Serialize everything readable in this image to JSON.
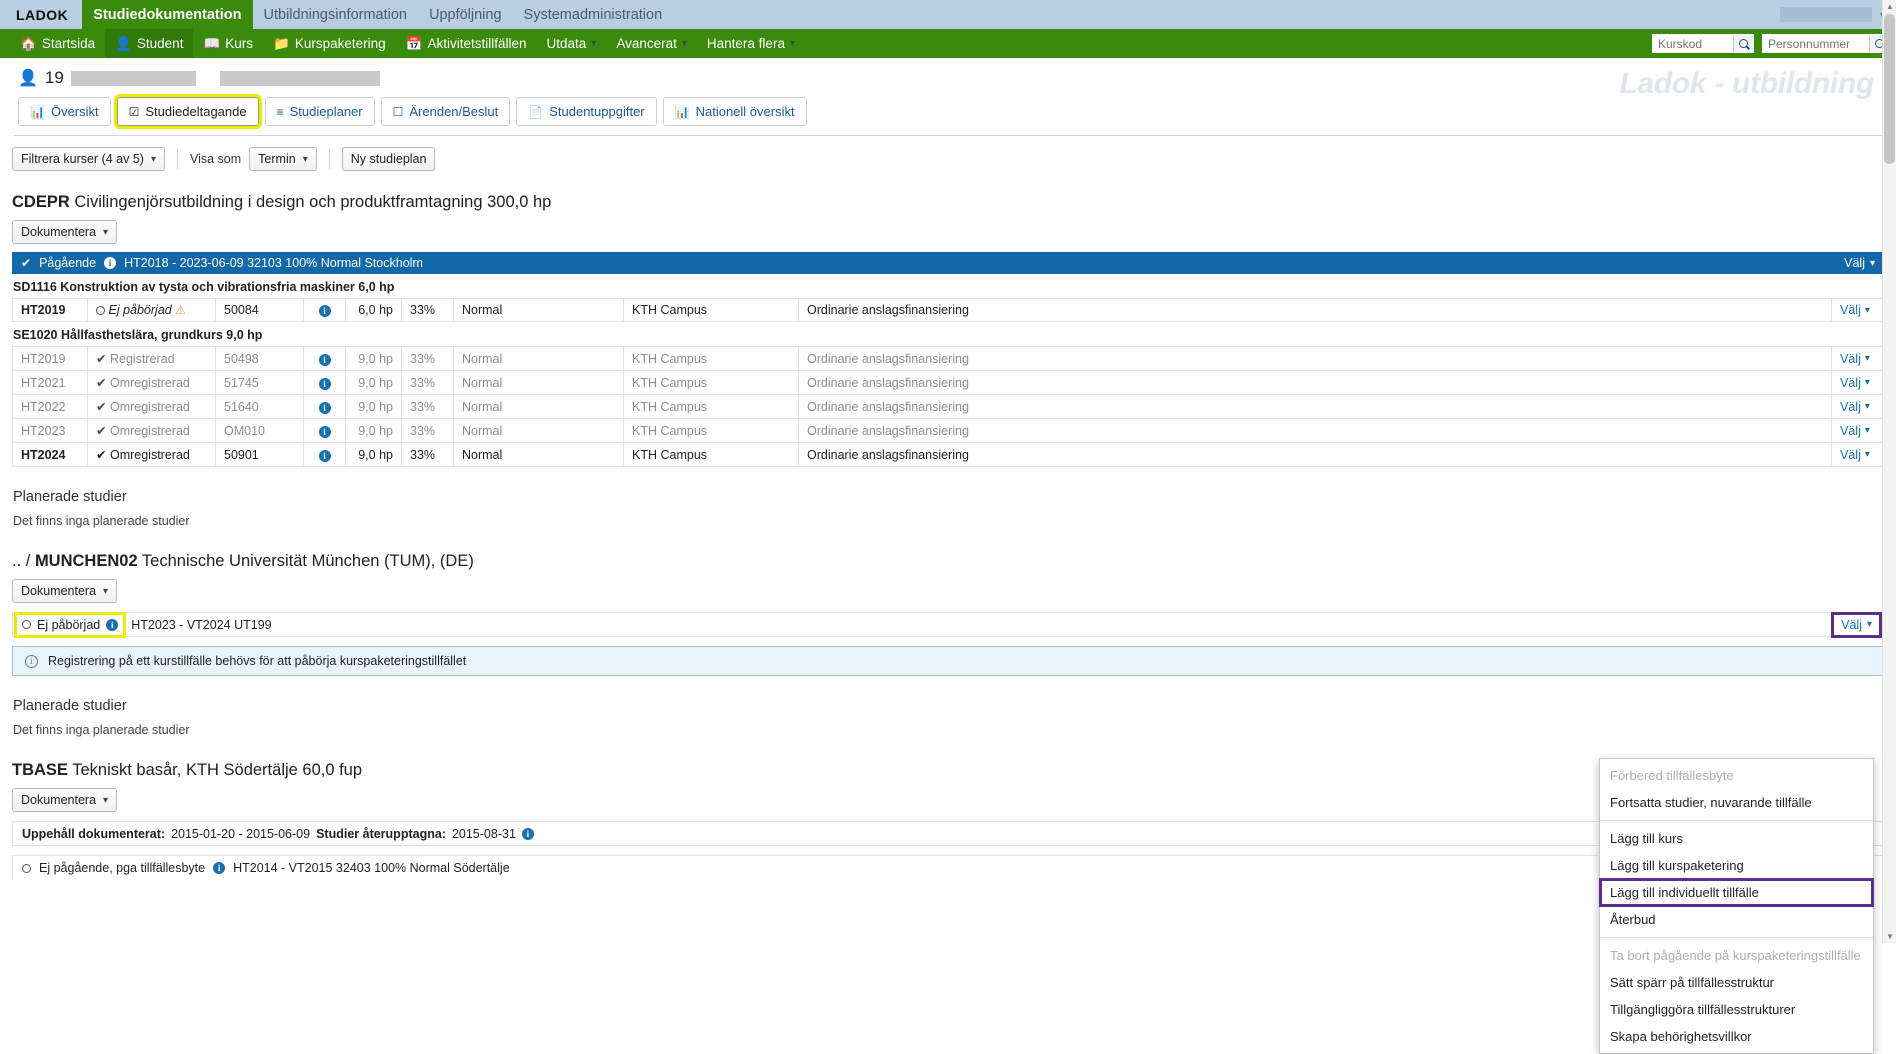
{
  "appbar": {
    "brand": "LADOK",
    "tabs": [
      {
        "label": "Studiedokumentation",
        "active": true
      },
      {
        "label": "Utbildningsinformation",
        "active": false
      },
      {
        "label": "Uppföljning",
        "active": false
      },
      {
        "label": "Systemadministration",
        "active": false
      }
    ],
    "unit_select_value": "",
    "chevron_icon": "chevron-down-icon"
  },
  "nav": {
    "items": [
      {
        "label": "Startsida",
        "icon": "home-icon",
        "caret": false,
        "active": false
      },
      {
        "label": "Student",
        "icon": "person-icon",
        "caret": false,
        "active": true
      },
      {
        "label": "Kurs",
        "icon": "book-icon",
        "caret": false,
        "active": false
      },
      {
        "label": "Kurspaketering",
        "icon": "folder-icon",
        "caret": false,
        "active": false
      },
      {
        "label": "Aktivitetstillfällen",
        "icon": "calendar-icon",
        "caret": false,
        "active": false
      },
      {
        "label": "Utdata",
        "icon": "",
        "caret": true,
        "active": false
      },
      {
        "label": "Avancerat",
        "icon": "",
        "caret": true,
        "active": false
      },
      {
        "label": "Hantera flera",
        "icon": "",
        "caret": true,
        "active": false
      }
    ],
    "search_kurskod_placeholder": "Kurskod",
    "search_kurskod_value": "",
    "search_personnummer_placeholder": "Personnummer",
    "search_personnummer_value": ""
  },
  "page": {
    "watermark": "Ladok - utbildning",
    "student_prefix": "19",
    "student_name_redacted": true
  },
  "student_tabs": [
    {
      "label": "Översikt",
      "icon": "chart-icon",
      "selected": false
    },
    {
      "label": "Studiedeltagande",
      "icon": "checkbox-checked-icon",
      "selected": true
    },
    {
      "label": "Studieplaner",
      "icon": "list-icon",
      "selected": false
    },
    {
      "label": "Ärenden/Beslut",
      "icon": "message-icon",
      "selected": false
    },
    {
      "label": "Studentuppgifter",
      "icon": "document-icon",
      "selected": false
    },
    {
      "label": "Nationell översikt",
      "icon": "chart-icon",
      "selected": false
    }
  ],
  "filterbar": {
    "filter_label": "Filtrera kurser (4 av 5)",
    "visa_som_label": "Visa som",
    "visa_som_value": "Termin",
    "ny_studieplan_label": "Ny studieplan"
  },
  "packages": [
    {
      "code": "CDEPR",
      "name": "Civilingenjörsutbildning i design och produktframtagning 300,0 hp",
      "dokumentera_label": "Dokumentera",
      "status_bar": {
        "status": "Pågående",
        "text": "HT2018 - 2023-06-09 32103 100% Normal Stockholm",
        "valj_label": "Välj"
      },
      "course_groups": [
        {
          "heading": "SD1116 Konstruktion av tysta och vibrationsfria maskiner 6,0 hp",
          "rows": [
            {
              "term": "HT2019",
              "status": "Ej påbörjad",
              "status_icon": "circle-empty-icon",
              "warn": true,
              "code": "50084",
              "hp": "6,0 hp",
              "pct": "33%",
              "takt": "Normal",
              "loc": "KTH Campus",
              "fin": "Ordinarie anslagsfinansiering",
              "valj": "Välj",
              "dim": false,
              "italic": true
            }
          ]
        },
        {
          "heading": "SE1020 Hållfasthetslära, grundkurs 9,0 hp",
          "rows": [
            {
              "term": "HT2019",
              "status": "Registrerad",
              "status_icon": "check-circle-icon",
              "warn": false,
              "code": "50498",
              "hp": "9,0 hp",
              "pct": "33%",
              "takt": "Normal",
              "loc": "KTH Campus",
              "fin": "Ordinarie anslagsfinansiering",
              "valj": "Välj",
              "dim": true,
              "italic": false
            },
            {
              "term": "HT2021",
              "status": "Omregistrerad",
              "status_icon": "check-circle-icon",
              "warn": false,
              "code": "51745",
              "hp": "9,0 hp",
              "pct": "33%",
              "takt": "Normal",
              "loc": "KTH Campus",
              "fin": "Ordinarie anslagsfinansiering",
              "valj": "Välj",
              "dim": true,
              "italic": false
            },
            {
              "term": "HT2022",
              "status": "Omregistrerad",
              "status_icon": "check-circle-icon",
              "warn": false,
              "code": "51640",
              "hp": "9,0 hp",
              "pct": "33%",
              "takt": "Normal",
              "loc": "KTH Campus",
              "fin": "Ordinarie anslagsfinansiering",
              "valj": "Välj",
              "dim": true,
              "italic": false
            },
            {
              "term": "HT2023",
              "status": "Omregistrerad",
              "status_icon": "check-circle-icon",
              "warn": false,
              "code": "OM010",
              "hp": "9,0 hp",
              "pct": "33%",
              "takt": "Normal",
              "loc": "KTH Campus",
              "fin": "Ordinarie anslagsfinansiering",
              "valj": "Välj",
              "dim": true,
              "italic": false
            },
            {
              "term": "HT2024",
              "status": "Omregistrerad",
              "status_icon": "check-circle-icon",
              "warn": false,
              "code": "50901",
              "hp": "9,0 hp",
              "pct": "33%",
              "takt": "Normal",
              "loc": "KTH Campus",
              "fin": "Ordinarie anslagsfinansiering",
              "valj": "Välj",
              "dim": false,
              "italic": false
            }
          ]
        }
      ],
      "planned_heading": "Planerade studier",
      "planned_text": "Det finns inga planerade studier"
    },
    {
      "breadcrumb": ".. /",
      "code": "MUNCHEN02",
      "name": "Technische Universität München (TUM), (DE)",
      "dokumentera_label": "Dokumentera",
      "ej_status": "Ej påbörjad",
      "ej_text": "HT2023 - VT2024 UT199",
      "valj_label": "Välj",
      "info_message": "Registrering på ett kurstillfälle behövs för att påbörja kurspaketeringstillfället",
      "planned_heading": "Planerade studier",
      "planned_text": "Det finns inga planerade studier"
    },
    {
      "code": "TBASE",
      "name": "Tekniskt basår, KTH Södertälje 60,0 fup",
      "dokumentera_label": "Dokumentera",
      "uppehall_label": "Uppehåll dokumenterat:",
      "uppehall_range": "2015-01-20 - 2015-06-09",
      "ateruppt_label": "Studier återupptagna:",
      "ateruppt_date": "2015-08-31",
      "row_status": "Ej pågående, pga tillfällesbyte",
      "row_text": "HT2014 - VT2015 32403 100% Normal Södertälje"
    }
  ],
  "dropdown": {
    "items": [
      {
        "label": "Förbered tillfällesbyte",
        "disabled": true,
        "highlight": false,
        "sep_after": false
      },
      {
        "label": "Fortsatta studier, nuvarande tillfälle",
        "disabled": false,
        "highlight": false,
        "sep_after": true
      },
      {
        "label": "Lägg till kurs",
        "disabled": false,
        "highlight": false,
        "sep_after": false
      },
      {
        "label": "Lägg till kurspaketering",
        "disabled": false,
        "highlight": false,
        "sep_after": false
      },
      {
        "label": "Lägg till individuellt tillfälle",
        "disabled": false,
        "highlight": true,
        "sep_after": false
      },
      {
        "label": "Återbud",
        "disabled": false,
        "highlight": false,
        "sep_after": true
      },
      {
        "label": "Ta bort pågående på kurspaketeringstillfälle",
        "disabled": true,
        "highlight": false,
        "sep_after": false
      },
      {
        "label": "Sätt spärr på tillfällesstruktur",
        "disabled": false,
        "highlight": false,
        "sep_after": false
      },
      {
        "label": "Tillgängliggöra tillfällesstrukturer",
        "disabled": false,
        "highlight": false,
        "sep_after": false
      },
      {
        "label": "Skapa behörighetsvillkor",
        "disabled": false,
        "highlight": false,
        "sep_after": false
      }
    ]
  },
  "colors": {
    "nav_green": "#3a8a0c",
    "appbar_blue": "#b9cde3",
    "status_blue": "#1268a8",
    "link_blue": "#1a6fad",
    "highlight_yellow": "#ecec00",
    "highlight_purple": "#5b2d8e",
    "info_bg": "#e8f3fb"
  }
}
